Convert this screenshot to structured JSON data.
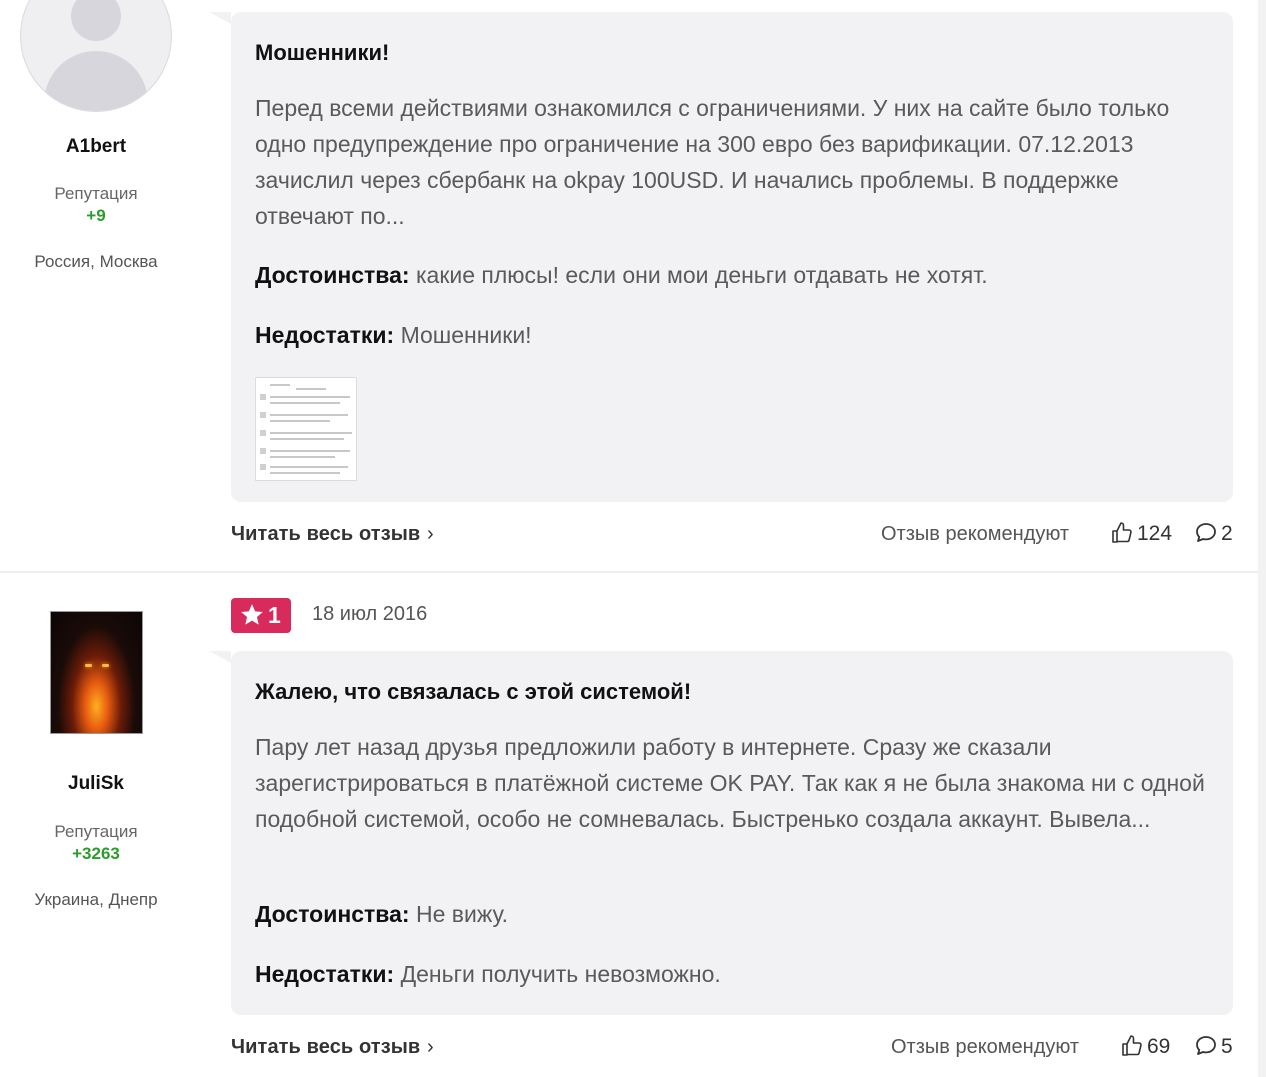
{
  "reviews": [
    {
      "author": {
        "name": "A1bert",
        "rep_label": "Репутация",
        "rep_value": "+9",
        "location": "Россия, Москва"
      },
      "title": "Мошенники!",
      "text": "Перед всеми действиями ознакомился с ограничениями. У них на сайте было только одно предупреждение про ограничение на 300 евро без варификации. 07.12.2013 зачислил через сбербанк на okpay 100USD. И начались проблемы. В поддержке отвечают по...",
      "pros_label": "Достоинства:",
      "pros": "какие плюсы! если они мои деньги отдавать не хотят.",
      "cons_label": "Недостатки:",
      "cons": "Мошенники!",
      "read_more": "Читать весь отзыв",
      "recommend_label": "Отзыв рекомендуют",
      "likes": "124",
      "comments": "2"
    },
    {
      "rating": "1",
      "date": "18 июл 2016",
      "author": {
        "name": "JuliSk",
        "rep_label": "Репутация",
        "rep_value": "+3263",
        "location": "Украина, Днепр"
      },
      "title": "Жалею, что связалась с этой системой!",
      "text": "Пару лет назад друзья предложили работу в интернете. Сразу же сказали зарегистрироваться в платёжной системе OK PAY. Так как я не была знакома ни с одной подобной системой, особо не сомневалась. Быстренько создала аккаунт. Вывела...",
      "pros_label": "Достоинства:",
      "pros": "Не вижу.",
      "cons_label": "Недостатки:",
      "cons": "Деньги получить невозможно.",
      "read_more": "Читать весь отзыв",
      "recommend_label": "Отзыв рекомендуют",
      "likes": "69",
      "comments": "5"
    }
  ],
  "colors": {
    "badge": "#d82a5d",
    "reputation": "#2a9d2a",
    "card_bg": "#f2f2f4"
  },
  "icons": [
    "default-avatar-icon",
    "chevron-right-icon",
    "thumbs-up-icon",
    "comment-icon",
    "star-icon"
  ]
}
